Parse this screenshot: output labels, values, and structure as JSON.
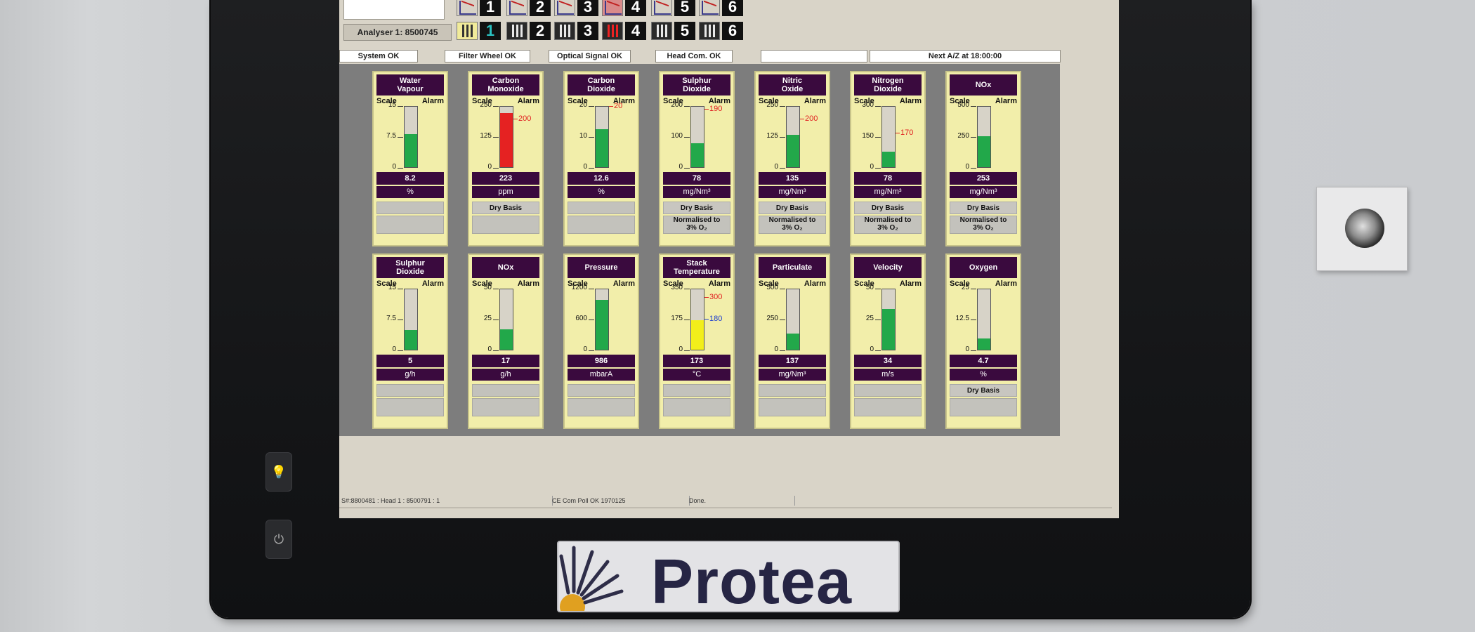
{
  "top": {
    "analyser_label": "Analyser 1: 8500745",
    "chart_buttons": [
      "1",
      "2",
      "3",
      "4",
      "5",
      "6"
    ],
    "bar_buttons": [
      "1",
      "2",
      "3",
      "4",
      "5",
      "6"
    ]
  },
  "status": {
    "system": "System OK",
    "filter_wheel": "Filter Wheel OK",
    "optical_signal": "Optical Signal OK",
    "head_com": "Head Com. OK",
    "blank": "",
    "next_az": "Next A/Z at 18:00:00"
  },
  "gauges": [
    {
      "title": "Water\nVapour",
      "scale": [
        "15",
        "7.5",
        "0"
      ],
      "alarm": "",
      "value": "8.2",
      "unit": "%",
      "level": 0.55,
      "color": "#22a84a",
      "extra": "",
      "norm": ""
    },
    {
      "title": "Carbon\nMonoxide",
      "scale": [
        "250",
        "125",
        "0"
      ],
      "alarm": "200",
      "alarm_pos": 0.8,
      "value": "223",
      "unit": "ppm",
      "level": 0.89,
      "color": "#e52222",
      "extra": "Dry Basis",
      "norm": ""
    },
    {
      "title": "Carbon\nDioxide",
      "scale": [
        "20",
        "10",
        "0"
      ],
      "alarm": "20",
      "alarm_pos": 1.0,
      "value": "12.6",
      "unit": "%",
      "level": 0.63,
      "color": "#22a84a",
      "extra": "",
      "norm": ""
    },
    {
      "title": "Sulphur\nDioxide",
      "scale": [
        "200",
        "100",
        "0"
      ],
      "alarm": "190",
      "alarm_pos": 0.95,
      "value": "78",
      "unit": "mg/Nm³",
      "level": 0.39,
      "color": "#22a84a",
      "extra": "Dry Basis",
      "norm": "Normalised to\n3% O₂"
    },
    {
      "title": "Nitric\nOxide",
      "scale": [
        "250",
        "125",
        "0"
      ],
      "alarm": "200",
      "alarm_pos": 0.8,
      "value": "135",
      "unit": "mg/Nm³",
      "level": 0.54,
      "color": "#22a84a",
      "extra": "Dry Basis",
      "norm": "Normalised to\n3% O₂"
    },
    {
      "title": "Nitrogen\nDioxide",
      "scale": [
        "300",
        "150",
        "0"
      ],
      "alarm": "170",
      "alarm_pos": 0.57,
      "value": "78",
      "unit": "mg/Nm³",
      "level": 0.26,
      "color": "#22a84a",
      "extra": "Dry Basis",
      "norm": "Normalised to\n3% O₂"
    },
    {
      "title": "NOx",
      "scale": [
        "500",
        "250",
        "0"
      ],
      "alarm": "",
      "value": "253",
      "unit": "mg/Nm³",
      "level": 0.51,
      "color": "#22a84a",
      "extra": "Dry Basis",
      "norm": "Normalised to\n3% O₂"
    },
    {
      "title": "Sulphur\nDioxide",
      "scale": [
        "15",
        "7.5",
        "0"
      ],
      "alarm": "",
      "value": "5",
      "unit": "g/h",
      "level": 0.33,
      "color": "#22a84a",
      "extra": "",
      "norm": ""
    },
    {
      "title": "NOx",
      "scale": [
        "50",
        "25",
        "0"
      ],
      "alarm": "",
      "value": "17",
      "unit": "g/h",
      "level": 0.34,
      "color": "#22a84a",
      "extra": "",
      "norm": ""
    },
    {
      "title": "Pressure",
      "scale": [
        "1200",
        "600",
        "0"
      ],
      "alarm": "",
      "value": "986",
      "unit": "mbarA",
      "level": 0.82,
      "color": "#22a84a",
      "extra": "",
      "norm": ""
    },
    {
      "title": "Stack\nTemperature",
      "scale": [
        "350",
        "175",
        "0"
      ],
      "alarm": "300",
      "alarm_pos": 0.86,
      "alarm2": "180",
      "alarm2_pos": 0.51,
      "value": "173",
      "unit": "°C",
      "level": 0.49,
      "color": "#f2ee1a",
      "extra": "",
      "norm": ""
    },
    {
      "title": "Particulate",
      "scale": [
        "500",
        "250",
        "0"
      ],
      "alarm": "",
      "value": "137",
      "unit": "mg/Nm³",
      "level": 0.27,
      "color": "#22a84a",
      "extra": "",
      "norm": ""
    },
    {
      "title": "Velocity",
      "scale": [
        "50",
        "25",
        "0"
      ],
      "alarm": "",
      "value": "34",
      "unit": "m/s",
      "level": 0.68,
      "color": "#22a84a",
      "extra": "",
      "norm": ""
    },
    {
      "title": "Oxygen",
      "scale": [
        "25",
        "12.5",
        "0"
      ],
      "alarm": "",
      "value": "4.7",
      "unit": "%",
      "level": 0.19,
      "color": "#22a84a",
      "extra": "Dry Basis",
      "norm": ""
    }
  ],
  "bottom_status": {
    "cell1": "S#:8800481 : Head 1 : 8500791 : 1",
    "cell2": "CE Com Poll OK 1970125",
    "cell3": "Done."
  },
  "logo": "Protea"
}
